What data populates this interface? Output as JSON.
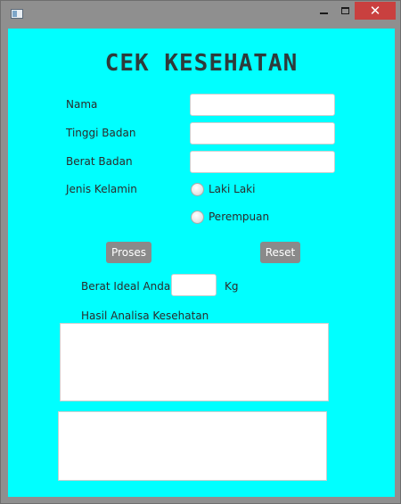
{
  "window": {
    "close_glyph": "✕"
  },
  "form": {
    "title": "CEK KESEHATAN",
    "nama_label": "Nama",
    "nama_value": "",
    "tinggi_label": "Tinggi Badan",
    "tinggi_value": "",
    "berat_label": "Berat Badan",
    "berat_value": "",
    "jenis_kelamin_label": "Jenis Kelamin",
    "radio_laki": "Laki Laki",
    "radio_perempuan": "Perempuan",
    "proses_label": "Proses",
    "reset_label": "Reset",
    "berat_ideal_label": "Berat Ideal Anda",
    "berat_ideal_value": "",
    "kg_label": "Kg",
    "hasil_label": "Hasil Analisa Kesehatan",
    "hasil_text": "",
    "extra_text": ""
  },
  "colors": {
    "background": "#00ffff",
    "button": "#8a8a8a",
    "close_button": "#c9403f"
  }
}
